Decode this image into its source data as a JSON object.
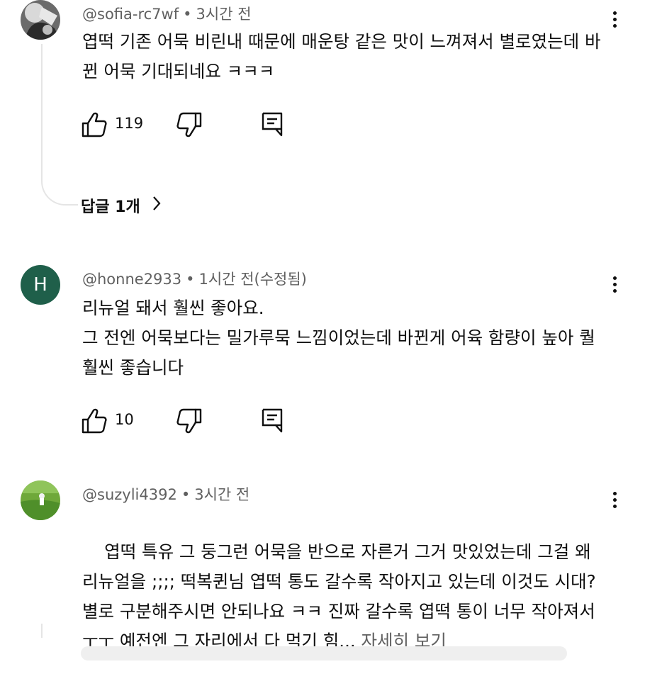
{
  "comments": [
    {
      "author": "@sofia-rc7wf",
      "time": "3시간 전",
      "text": "엽떡 기존 어묵 비린내 때문에 매운탕 같은 맛이 느껴져서 별로였는데 바뀐 어묵 기대되네요 ㅋㅋㅋ",
      "likes": "119",
      "avatar": "photo-avatar",
      "replies_label": "답글 1개"
    },
    {
      "author": "@honne2933",
      "time": "1시간 전(수정됨)",
      "text": "리뉴얼 돼서 훨씬 좋아요.\n그 전엔 어묵보다는 밀가루묵 느낌이었는데 바뀐게 어육 함량이 높아 퀄 훨씬 좋습니다",
      "likes": "10",
      "avatar_letter": "H",
      "avatar_color": "#1f5f4a"
    },
    {
      "author": "@suzyli4392",
      "time": "3시간 전",
      "text": "엽떡 특유 그 둥그런 어묵을 반으로 자른거 그거 맛있었는데 그걸 왜 리뉴얼을 ;;;; 떡복퀸님 엽떡 통도 갈수록 작아지고 있는데 이것도 시대?별로 구분해주시면 안되나요 ㅋㅋ 진짜 갈수록 엽떡 통이 너무 작아져서 ㅜㅜ 예전엔 그 자리에서 다 먹기 힘...",
      "more_label": "자세히 보기",
      "avatar": "field-photo-avatar"
    }
  ],
  "icons": {
    "like": "thumbs-up-icon",
    "dislike": "thumbs-down-icon",
    "reply": "reply-comment-icon",
    "menu": "more-vertical-icon",
    "chevron": "chevron-right-icon"
  }
}
